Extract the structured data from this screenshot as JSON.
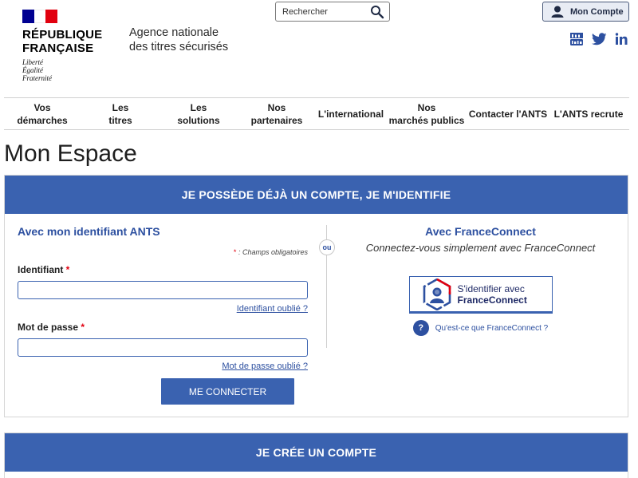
{
  "header": {
    "republic_line1": "RÉPUBLIQUE",
    "republic_line2": "FRANÇAISE",
    "motto1": "Liberté",
    "motto2": "Égalité",
    "motto3": "Fraternité",
    "agency_line1": "Agence nationale",
    "agency_line2": "des titres sécurisés",
    "search_placeholder": "Rechercher",
    "account_label": "Mon Compte",
    "social_icons": [
      "youtube-icon",
      "twitter-icon",
      "linkedin-icon"
    ]
  },
  "nav": {
    "items": [
      {
        "l1": "Vos",
        "l2": "démarches"
      },
      {
        "l1": "Les",
        "l2": "titres"
      },
      {
        "l1": "Les",
        "l2": "solutions"
      },
      {
        "l1": "Nos",
        "l2": "partenaires"
      },
      {
        "l1": "L'international",
        "l2": ""
      },
      {
        "l1": "Nos",
        "l2": "marchés publics"
      },
      {
        "l1": "Contacter l'ANTS",
        "l2": ""
      },
      {
        "l1": "L'ANTS recrute",
        "l2": ""
      }
    ]
  },
  "page": {
    "title": "Mon Espace"
  },
  "login": {
    "heading": "JE POSSÈDE DÉJÀ UN COMPTE, JE M'IDENTIFIE",
    "ants_title": "Avec mon identifiant ANTS",
    "required_note": ": Champs obligatoires",
    "required_star": "*",
    "identifiant_label": "Identifiant",
    "identifiant_value": "",
    "identifiant_forgot": "Identifiant oublié ?",
    "password_label": "Mot de passe",
    "password_value": "",
    "password_forgot": "Mot de passe oublié ?",
    "submit_label": "ME CONNECTER",
    "or_label": "ou",
    "fc_title": "Avec FranceConnect",
    "fc_subtitle": "Connectez-vous simplement avec FranceConnect",
    "fc_button_line1": "S'identifier avec",
    "fc_button_line2": "FranceConnect",
    "fc_what_mark": "?",
    "fc_what_label": "Qu'est-ce que FranceConnect ?"
  },
  "create": {
    "heading": "JE CRÉE UN COMPTE"
  },
  "colors": {
    "primary": "#3a62b0",
    "link": "#2d50a0",
    "required": "#e1000f"
  }
}
